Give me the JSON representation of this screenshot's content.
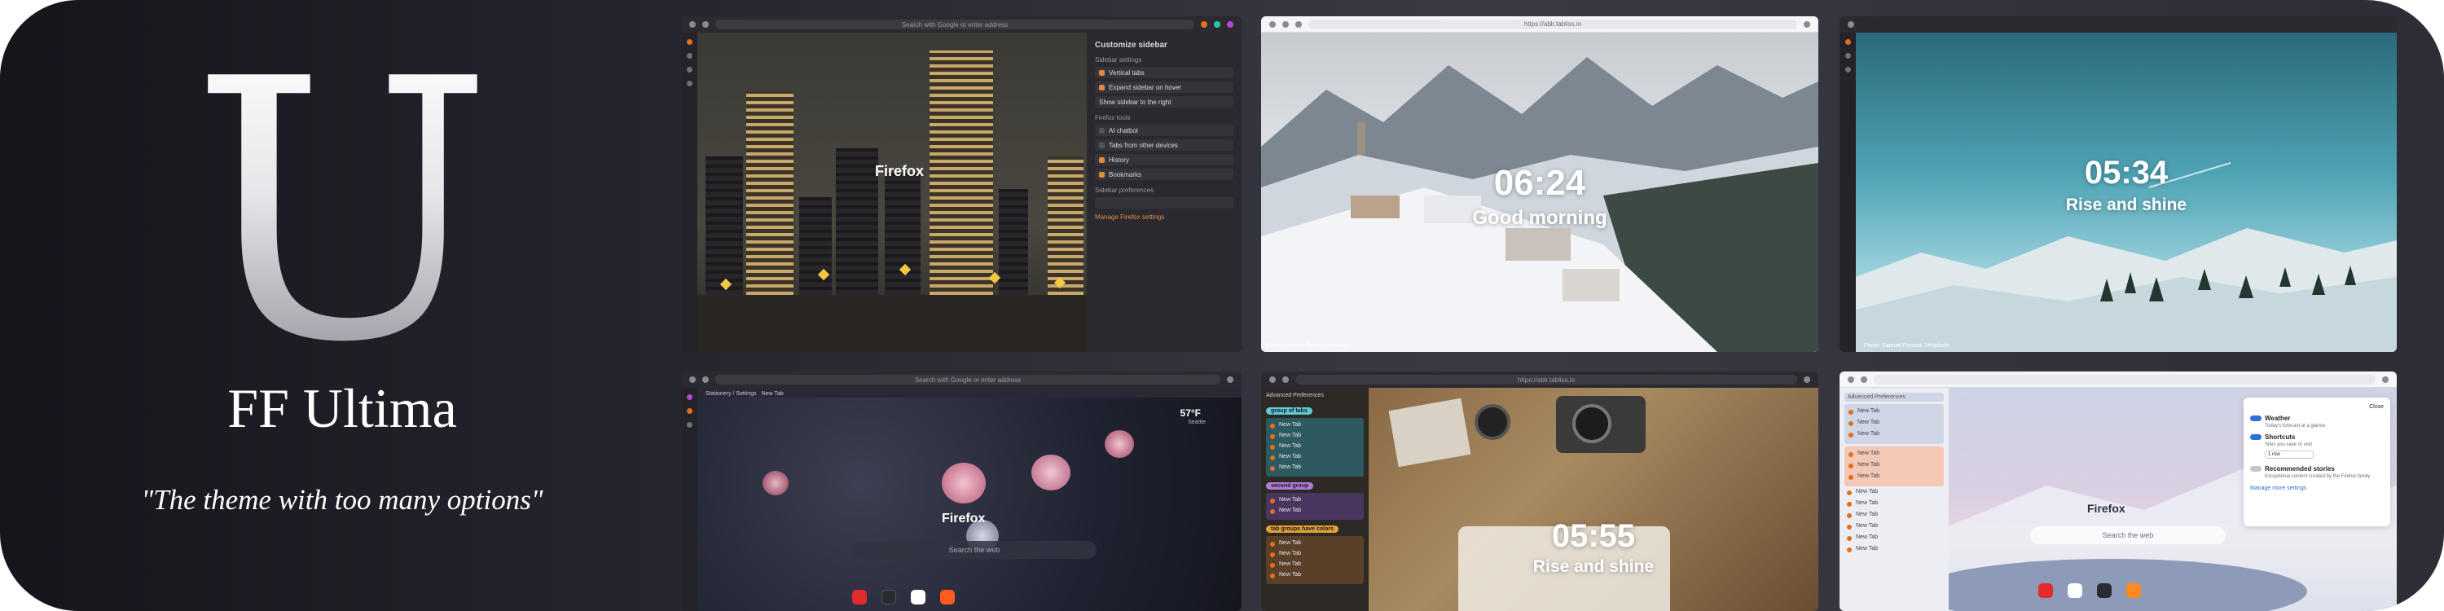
{
  "brand": {
    "letter": "U",
    "name": "FF Ultima",
    "tagline": "\"The theme with too many options\""
  },
  "screens": {
    "s1": {
      "url_placeholder": "Search with Google or enter address",
      "page_title": "Firefox",
      "settings": {
        "title": "Customize sidebar",
        "section_sidebar": "Sidebar settings",
        "vertical_tabs": "Vertical tabs",
        "expand_on_hover": "Expand sidebar on hover",
        "show_right": "Show sidebar to the right",
        "section_tools": "Firefox tools",
        "ai_chatbot": "AI chatbot",
        "tabs_other_devices": "Tabs from other devices",
        "history": "History",
        "bookmarks": "Bookmarks",
        "section_prefs": "Sidebar preferences",
        "manage": "Manage Firefox settings"
      }
    },
    "s2": {
      "url": "https://ablr.tabliss.io",
      "time": "06:24",
      "greeting": "Good morning",
      "credit": "Photo: Lorenzo Rossi, Unsplash"
    },
    "s3": {
      "time": "05:34",
      "greeting": "Rise and shine",
      "credit": "Photo: Samuel Ferrara, Unsplash"
    },
    "s4": {
      "url_placeholder": "Search with Google or enter address",
      "tab1": "Stationery / Settings",
      "tab2": "New Tab",
      "weather": "57°F",
      "weather_place": "Seattle",
      "page_title": "Firefox",
      "search_placeholder": "Search the web"
    },
    "s5": {
      "url": "https://ablr.tabliss.io",
      "header": "Advanced Preferences",
      "group1": "group of tabs",
      "group2": "second group",
      "group3": "tab groups have colors",
      "tab_label": "New Tab",
      "time": "05:55",
      "greeting": "Rise and shine"
    },
    "s6": {
      "header": "Advanced Preferences",
      "tab_label": "New Tab",
      "page_title": "Firefox",
      "search_placeholder": "Search the web",
      "panel": {
        "close": "Close",
        "weather": "Weather",
        "weather_desc": "Today's forecast at a glance",
        "shortcuts": "Shortcuts",
        "shortcuts_desc": "Sites you save or visit",
        "rows": "1 row",
        "stories": "Recommended stories",
        "stories_desc": "Exceptional content curated by the Firefox family",
        "manage": "Manage more settings"
      }
    }
  },
  "colors": {
    "accent_orange": "#e0701c",
    "toggle_blue": "#2f6fdb"
  }
}
